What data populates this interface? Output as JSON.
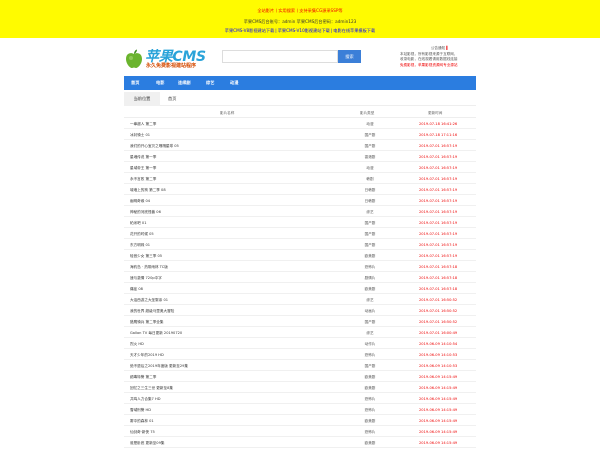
{
  "topbar": {
    "line1": "全站影片丨实用搜索丨支持采集CG源采SSP等",
    "line2": "苹果CMS后台账号：admin  苹果CMS后台密码：admin123",
    "line3": [
      "苹果CMS-V8影视建站下载",
      "苹果CMS-V10影视建站下载",
      "电影在线苹果模板下载"
    ]
  },
  "logo": {
    "brand": "苹果CMS",
    "slogan": "永久免费影视建站程序"
  },
  "search": {
    "placeholder": "",
    "button": "搜索"
  },
  "notice": {
    "title": "公告通知",
    "lines": [
      "本站影视，所有影视来源于互联网，",
      "收录电影，在线观看请用数据线连接",
      "免费影视，苹果影视资源网专业源站"
    ]
  },
  "nav": {
    "items": [
      "首页",
      "电影",
      "连续剧",
      "综艺",
      "动漫"
    ]
  },
  "breadcrumb": {
    "label": "当前位置",
    "current": "首页"
  },
  "table": {
    "headers": {
      "name": "影片名称",
      "category": "影片类型",
      "time": "更新时间"
    },
    "rows": [
      {
        "name": "一拳超人 第二季",
        "category": "动漫",
        "time": "2019-07-18 16:41:26"
      },
      {
        "name": "冰封骑士 01",
        "category": "国产剧",
        "time": "2019-07-18 17:11:16"
      },
      {
        "name": "我们的开心宝贝之嘎嘎星球 05",
        "category": "国产剧",
        "time": "2019-07-01 16:57:19"
      },
      {
        "name": "星魂传说 第一季",
        "category": "香港剧",
        "time": "2019-07-01 16:57:19"
      },
      {
        "name": "星域帝王 第一季",
        "category": "动漫",
        "time": "2019-07-01 16:57:19"
      },
      {
        "name": "永不言败 第二季",
        "category": "韩剧",
        "time": "2019-07-01 16:57:19"
      },
      {
        "name": "城墙上的狗 第二季 08",
        "category": "日韩剧",
        "time": "2019-07-01 16:57:19"
      },
      {
        "name": "幽明奇缘 04",
        "category": "日韩剧",
        "time": "2019-07-01 16:57:19"
      },
      {
        "name": "神秘的河底怪兽 06",
        "category": "综艺",
        "time": "2019-07-01 16:57:19"
      },
      {
        "name": "帕米吧 01",
        "category": "国产剧",
        "time": "2019-07-01 16:57:19"
      },
      {
        "name": "花开的时候 05",
        "category": "国产剧",
        "time": "2019-07-01 16:57:19"
      },
      {
        "name": "东方明珠 01",
        "category": "国产剧",
        "time": "2019-07-01 16:57:19"
      },
      {
        "name": "轻音少女 第三季 05",
        "category": "欧美剧",
        "time": "2019-07-01 16:57:19"
      },
      {
        "name": "海豹岛 · 热带雨林 TC版",
        "category": "恐怖片",
        "time": "2019-07-01 16:57:18"
      },
      {
        "name": "速与激情 720p中字",
        "category": "剧情片",
        "time": "2019-07-01 16:57:18"
      },
      {
        "name": "痛症 08",
        "category": "欧美剧",
        "time": "2019-07-01 16:57:18"
      },
      {
        "name": "大话西游之大圣娶亲 01",
        "category": "综艺",
        "time": "2019-07-01 16:50:52"
      },
      {
        "name": "我的世界 超级马里奥大冒险",
        "category": "动画片",
        "time": "2019-07-01 16:50:52"
      },
      {
        "name": "猎鹰骑兵 第二季全集",
        "category": "国产剧",
        "time": "2019-07-01 16:50:52"
      },
      {
        "name": "Gallon TV 每日更新 20190720",
        "category": "综艺",
        "time": "2019-07-01 16:00:49"
      },
      {
        "name": "烈火 HD",
        "category": "动作片",
        "time": "2019-06-09 14:10:54"
      },
      {
        "name": "天才少年的2019 HD",
        "category": "恐怖片",
        "time": "2019-06-09 14:10:53"
      },
      {
        "name": "绝不退后之2019年度版 更新至29集",
        "category": "国产剧",
        "time": "2019-06-09 14:10:53"
      },
      {
        "name": "缉毒特警 第二季",
        "category": "欧美剧",
        "time": "2019-06-09 14:15:49"
      },
      {
        "name": "回忆之三生三世 更新至8集",
        "category": "欧美剧",
        "time": "2019-06-09 14:15:49"
      },
      {
        "name": "共鸣人力合集7 HD",
        "category": "恐怖片",
        "time": "2019-06-09 14:15:49"
      },
      {
        "name": "雪域刑警 HD",
        "category": "恐怖片",
        "time": "2019-06-09 14:15:49"
      },
      {
        "name": "雾中的森林 01",
        "category": "欧美剧",
        "time": "2019-06-09 14:15:49"
      },
      {
        "name": "仙剑奇·新侠 75",
        "category": "恐怖片",
        "time": "2019-06-09 14:15:49"
      },
      {
        "name": "谁是卧底 更新至09集",
        "category": "欧美剧",
        "time": "2019-06-09 14:15:49"
      }
    ]
  },
  "colors": {
    "topbar_bg": "#fffb00",
    "nav_bg": "#2b7de0",
    "search_btn": "#3b7fd8",
    "time_red": "#e00000",
    "brand_blue": "#2aa3d9"
  }
}
